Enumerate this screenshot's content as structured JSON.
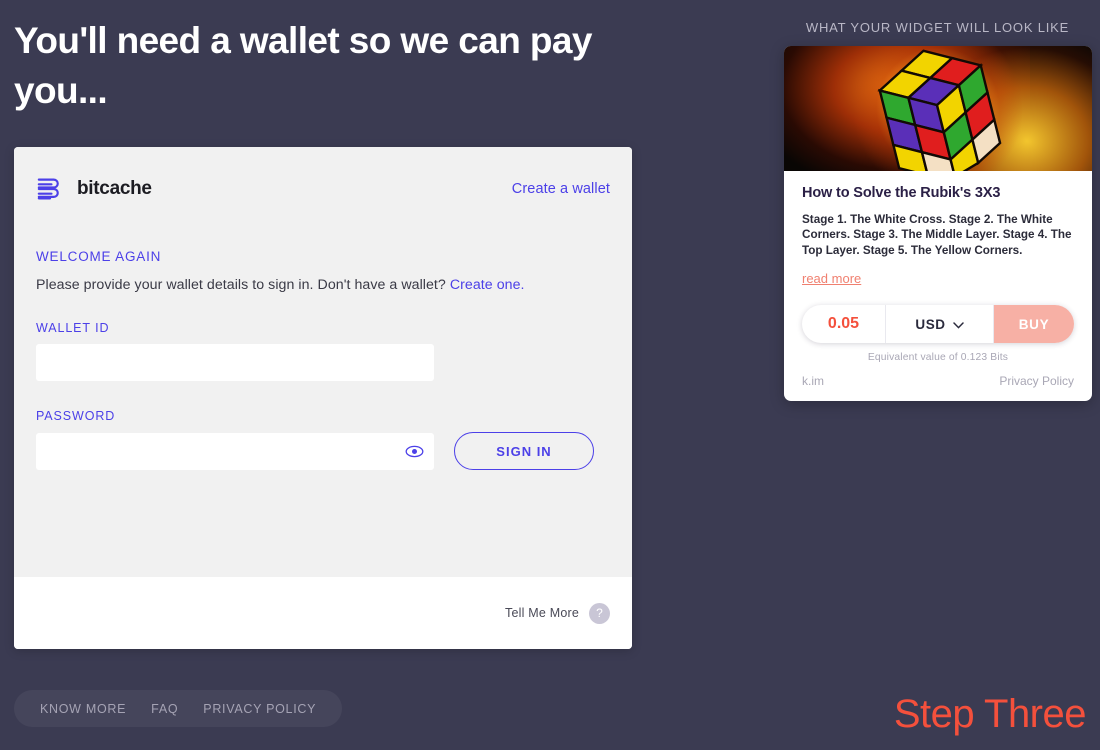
{
  "page": {
    "headline": "You'll need a wallet so we can pay you...",
    "step_label": "Step Three"
  },
  "auth_card": {
    "brand_name": "bitcache",
    "logo_icon": "bitcache-b-logo",
    "create_wallet_link": "Create a wallet",
    "welcome_label": "WELCOME AGAIN",
    "welcome_text": "Please provide your wallet details to sign in. Don't have a wallet?",
    "welcome_link": "Create one.",
    "wallet_id": {
      "label": "WALLET ID",
      "value": "",
      "placeholder": ""
    },
    "password": {
      "label": "PASSWORD",
      "value": "",
      "placeholder": "",
      "toggle_icon": "eye-icon"
    },
    "sign_in_button": "SIGN IN",
    "footer": {
      "tell_me_more": "Tell Me More",
      "help_badge": "?"
    }
  },
  "bottom_nav": {
    "items": [
      {
        "label": "KNOW MORE"
      },
      {
        "label": "FAQ"
      },
      {
        "label": "PRIVACY POLICY"
      }
    ]
  },
  "widget_preview": {
    "caption": "WHAT YOUR WIDGET WILL LOOK LIKE",
    "hero_image": "rubiks-cube-glow-image",
    "title": "How to Solve the Rubik's 3X3",
    "description": "Stage 1. The White Cross. Stage 2. The White Corners. Stage 3. The Middle Layer. Stage 4. The Top Layer. Stage 5. The Yellow Corners.",
    "read_more": "read more",
    "buy_bar": {
      "amount": "0.05",
      "currency": "USD",
      "currency_icon": "chevron-down-icon",
      "buy_label": "BUY"
    },
    "equivalent_note": "Equivalent value of 0.123 Bits",
    "footer": {
      "site": "k.im",
      "privacy": "Privacy Policy"
    }
  },
  "colors": {
    "background": "#3b3b52",
    "accent_purple": "#4c40e8",
    "accent_coral": "#f4503c",
    "buy_salmon": "#f7b0a5",
    "card_grey": "#f1f1f1"
  }
}
